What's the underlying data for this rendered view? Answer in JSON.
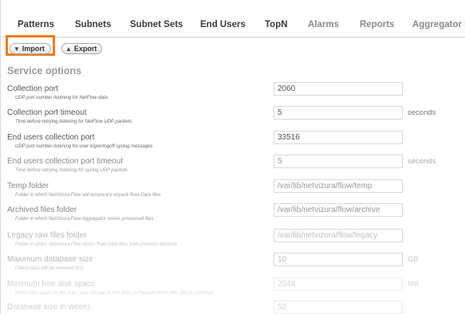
{
  "tabs": [
    {
      "label": "Patterns"
    },
    {
      "label": "Subnets"
    },
    {
      "label": "Subnet Sets"
    },
    {
      "label": "End Users"
    },
    {
      "label": "TopN"
    },
    {
      "label": "Alarms"
    },
    {
      "label": "Reports"
    },
    {
      "label": "Aggregator F"
    }
  ],
  "toolbar": {
    "import_label": "Import",
    "export_label": "Export"
  },
  "section": {
    "title": "Service options"
  },
  "options": [
    {
      "label": "Collection port",
      "desc": "UDP port number listening for NetFlow data",
      "value": "2060",
      "unit": ""
    },
    {
      "label": "Collection port timeout",
      "desc": "Time before retrying listening for NetFlow UDP packets",
      "value": "5",
      "unit": "seconds"
    },
    {
      "label": "End users collection port",
      "desc": "UDP port number listening for user logon/logoff syslog messages",
      "value": "33516",
      "unit": ""
    },
    {
      "label": "End users collection port timeout",
      "desc": "Time before retrying listening for syslog UDP packets",
      "value": "5",
      "unit": "seconds"
    },
    {
      "label": "Temp folder",
      "desc": "Folder in which NetVizura.Flow will temporary unpack Raw Data files",
      "value": "/var/lib/netvizura/flow/temp",
      "unit": ""
    },
    {
      "label": "Archived files folder",
      "desc": "Folder in which NetVizura.Flow Aggregator stores processed files",
      "value": "/var/lib/netvizura/flow/archive",
      "unit": ""
    },
    {
      "label": "Legacy raw files folder",
      "desc": "Folder in which NetVizura.Flow stores Raw Data files from previous versions",
      "value": "/var/lib/netvizura/flow/legacy",
      "unit": ""
    },
    {
      "label": "Maximum database size",
      "desc": "Oldest data will be removed first",
      "value": "10",
      "unit": "GB"
    },
    {
      "label": "Minimum free disk space",
      "desc": "When free space on the Raw Data storage is less than configured oldest files will be removed",
      "value": "2048",
      "unit": "MB"
    },
    {
      "label": "Database size in weeks",
      "desc": "",
      "value": "52",
      "unit": ""
    }
  ]
}
